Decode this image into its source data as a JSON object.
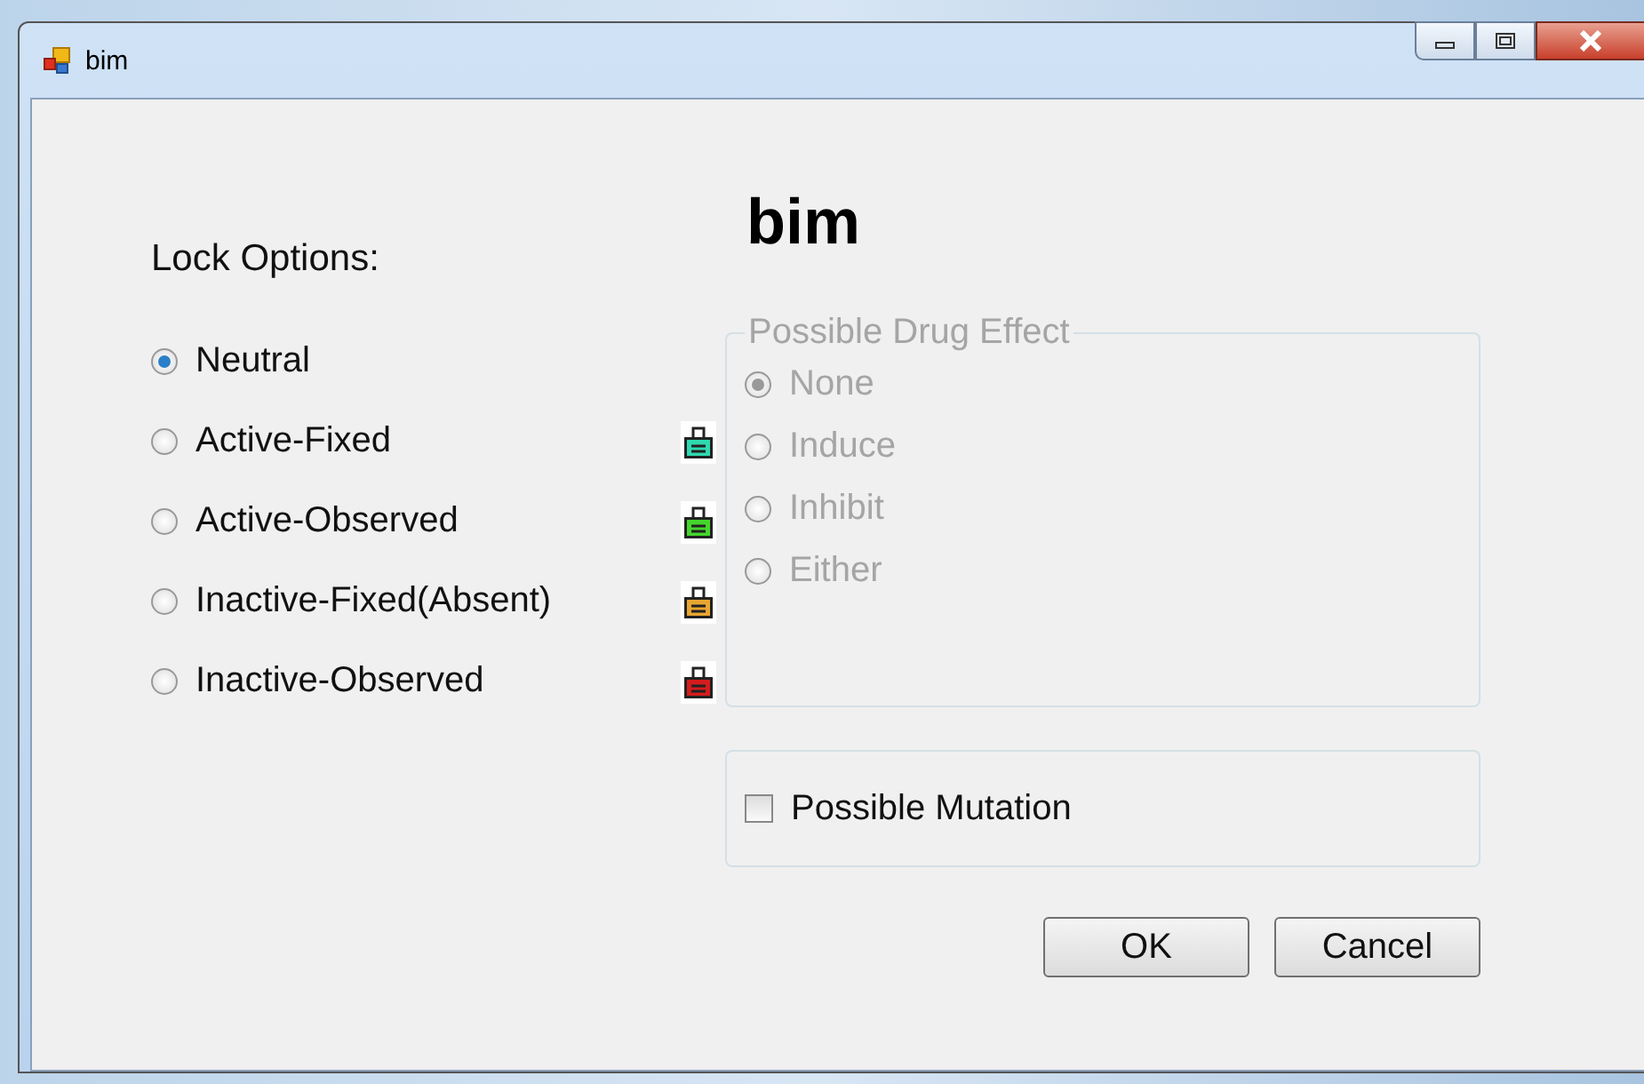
{
  "window": {
    "title": "bim"
  },
  "lock_options": {
    "label": "Lock Options:",
    "items": [
      {
        "label": "Neutral",
        "selected": true
      },
      {
        "label": "Active-Fixed",
        "selected": false,
        "color": "#2ed8b0"
      },
      {
        "label": "Active-Observed",
        "selected": false,
        "color": "#44d62c"
      },
      {
        "label": "Inactive-Fixed(Absent)",
        "selected": false,
        "color": "#e8a530"
      },
      {
        "label": "Inactive-Observed",
        "selected": false,
        "color": "#d41c1c"
      }
    ]
  },
  "heading": "bim",
  "drug_effect": {
    "title": "Possible Drug Effect",
    "disabled": true,
    "options": [
      {
        "label": "None",
        "selected": true
      },
      {
        "label": "Induce",
        "selected": false
      },
      {
        "label": "Inhibit",
        "selected": false
      },
      {
        "label": "Either",
        "selected": false
      }
    ]
  },
  "mutation": {
    "label": "Possible Mutation",
    "checked": false
  },
  "buttons": [
    "OK",
    "Cancel"
  ]
}
